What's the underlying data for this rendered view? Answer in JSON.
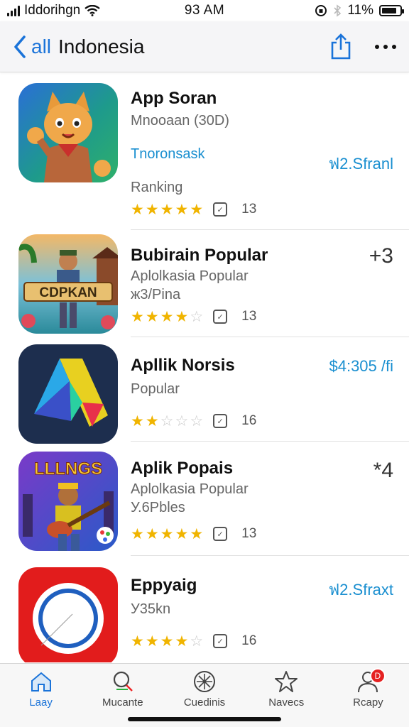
{
  "status_bar": {
    "carrier": "Iddorihgn",
    "time": "93 AM",
    "battery_percent": "11%",
    "battery_level": 0.85
  },
  "nav": {
    "back_label": "all",
    "title": "Indonesia"
  },
  "apps": [
    {
      "name": "App Soran",
      "lines": [
        "Mnooaan (30D)"
      ],
      "link": "Tnoronsask",
      "extra": "Ranking",
      "price": "ฟ2.Sfranl",
      "rank": "",
      "stars": 4.5,
      "rating_count": "13"
    },
    {
      "name": "Bubirain Popular",
      "lines": [
        "Aplolkasia Popular",
        "ж3/Pina"
      ],
      "link": "",
      "extra": "",
      "price": "",
      "rank": "+3",
      "stars": 3.5,
      "rating_count": "13",
      "icon_text": "CDPKAN"
    },
    {
      "name": "Apllik Norsis",
      "lines": [
        "Popular"
      ],
      "link": "",
      "extra": "",
      "price": "$4:305 /ﬁ",
      "rank": "",
      "stars": 1.5,
      "rating_count": "16"
    },
    {
      "name": "Aplik Popais",
      "lines": [
        "Aplolkasia Popular",
        "У.6Pbles"
      ],
      "link": "",
      "extra": "",
      "price": "",
      "rank": "*4",
      "stars": 5,
      "rating_count": "13",
      "icon_text": "LLLNGS"
    },
    {
      "name": "Eppyaig",
      "lines": [
        "У35kn"
      ],
      "link": "",
      "extra": "",
      "price": "ฟ2.Sfraxt",
      "rank": "",
      "stars": 3.5,
      "rating_count": "16"
    }
  ],
  "tabs": [
    {
      "label": "Laay",
      "icon": "home-icon",
      "active": true
    },
    {
      "label": "Mucante",
      "icon": "search-icon",
      "active": false
    },
    {
      "label": "Cuedinis",
      "icon": "compass-icon",
      "active": false
    },
    {
      "label": "Navecs",
      "icon": "star-icon",
      "active": false
    },
    {
      "label": "Rcapy",
      "icon": "person-icon",
      "active": false,
      "badge": "D"
    }
  ],
  "colors": {
    "accent_blue": "#1a73d9",
    "price_blue": "#1a8fd0",
    "star_gold": "#f0b400",
    "badge_red": "#e52222"
  }
}
